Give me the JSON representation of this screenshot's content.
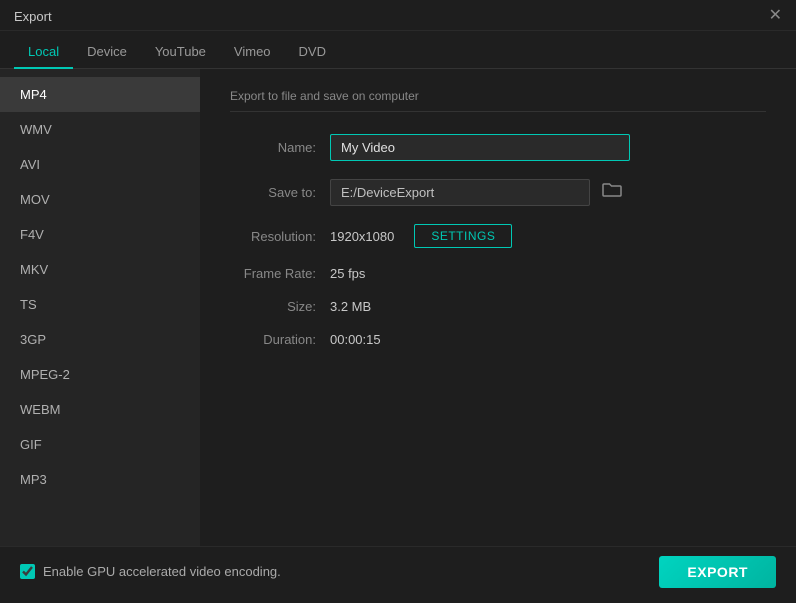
{
  "titleBar": {
    "title": "Export",
    "closeLabel": "✕"
  },
  "tabs": [
    {
      "id": "local",
      "label": "Local",
      "active": true
    },
    {
      "id": "device",
      "label": "Device",
      "active": false
    },
    {
      "id": "youtube",
      "label": "YouTube",
      "active": false
    },
    {
      "id": "vimeo",
      "label": "Vimeo",
      "active": false
    },
    {
      "id": "dvd",
      "label": "DVD",
      "active": false
    }
  ],
  "sidebar": {
    "items": [
      {
        "id": "mp4",
        "label": "MP4",
        "active": true
      },
      {
        "id": "wmv",
        "label": "WMV",
        "active": false
      },
      {
        "id": "avi",
        "label": "AVI",
        "active": false
      },
      {
        "id": "mov",
        "label": "MOV",
        "active": false
      },
      {
        "id": "f4v",
        "label": "F4V",
        "active": false
      },
      {
        "id": "mkv",
        "label": "MKV",
        "active": false
      },
      {
        "id": "ts",
        "label": "TS",
        "active": false
      },
      {
        "id": "3gp",
        "label": "3GP",
        "active": false
      },
      {
        "id": "mpeg2",
        "label": "MPEG-2",
        "active": false
      },
      {
        "id": "webm",
        "label": "WEBM",
        "active": false
      },
      {
        "id": "gif",
        "label": "GIF",
        "active": false
      },
      {
        "id": "mp3",
        "label": "MP3",
        "active": false
      }
    ]
  },
  "rightPanel": {
    "sectionTitle": "Export to file and save on computer",
    "fields": {
      "nameLabel": "Name:",
      "nameValue": "My Video",
      "saveToLabel": "Save to:",
      "saveToPath": "E:/DeviceExport",
      "resolutionLabel": "Resolution:",
      "resolutionValue": "1920x1080",
      "settingsLabel": "SETTINGS",
      "frameRateLabel": "Frame Rate:",
      "frameRateValue": "25 fps",
      "sizeLabel": "Size:",
      "sizeValue": "3.2 MB",
      "durationLabel": "Duration:",
      "durationValue": "00:00:15"
    }
  },
  "bottomBar": {
    "gpuLabel": "Enable GPU accelerated video encoding.",
    "gpuChecked": true,
    "exportLabel": "EXPORT"
  }
}
